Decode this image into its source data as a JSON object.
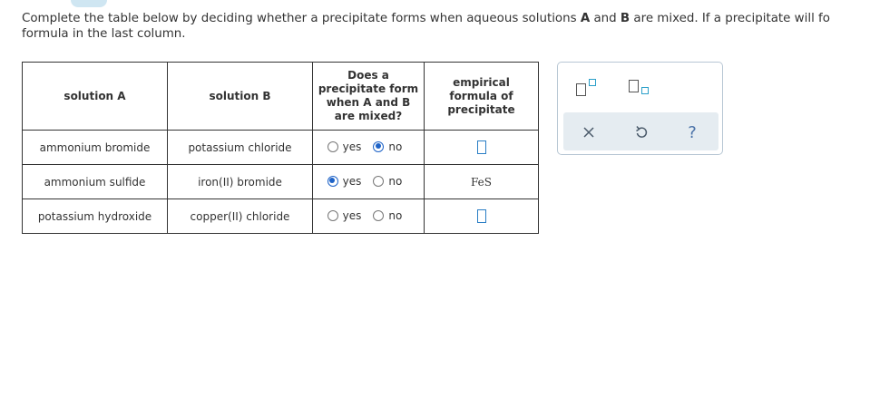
{
  "instructions": {
    "part1": "Complete the table below by deciding whether a precipitate forms when aqueous solutions ",
    "a": "A",
    "and": " and ",
    "b": "B",
    "part2": " are mixed. If a precipitate will fo",
    "line2": "formula in the last column."
  },
  "table": {
    "headers": {
      "solution_a": "solution A",
      "solution_b": "solution B",
      "precipitate": [
        "Does a",
        "precipitate form",
        "when A and B",
        "are mixed?"
      ],
      "formula": [
        "empirical",
        "formula of",
        "precipitate"
      ]
    },
    "rows": [
      {
        "a": "ammonium bromide",
        "b": "potassium chloride",
        "yes_label": "yes",
        "no_label": "no",
        "selected": "no",
        "formula": ""
      },
      {
        "a": "ammonium sulfide",
        "b": "iron(II) bromide",
        "yes_label": "yes",
        "no_label": "no",
        "selected": "yes",
        "formula": "FeS"
      },
      {
        "a": "potassium hydroxide",
        "b": "copper(II) chloride",
        "yes_label": "yes",
        "no_label": "no",
        "selected": "",
        "formula": ""
      }
    ]
  },
  "palette": {
    "tools": [
      "superscript-tool",
      "subscript-tool"
    ],
    "actions": [
      "clear-icon",
      "undo-icon",
      "help-icon"
    ],
    "help_glyph": "?",
    "accent_color": "#2a9fc9"
  }
}
